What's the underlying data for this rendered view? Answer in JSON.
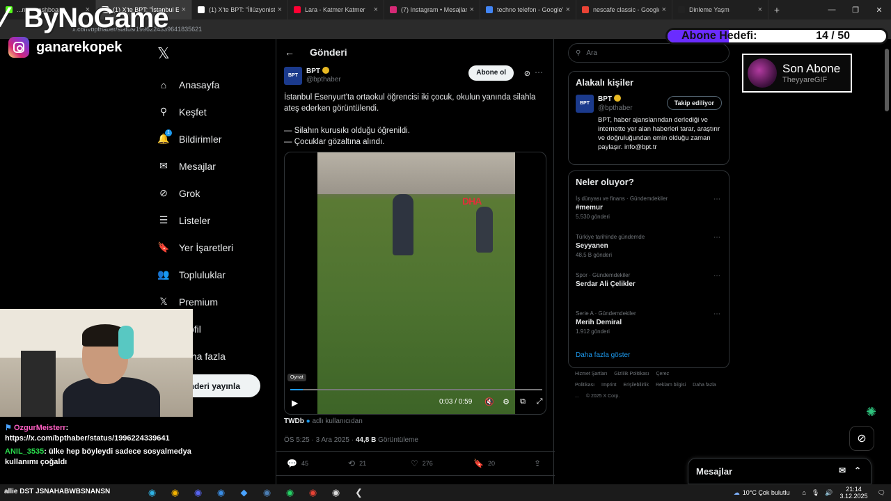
{
  "browser": {
    "tabs": [
      {
        "title": "...m - ...ashboard",
        "color": "#53fc18"
      },
      {
        "title": "(1) X'te BPT: \"İstanbul Ese",
        "color": "#ffffff",
        "active": true
      },
      {
        "title": "(1) X'te BPT: \"İllüzyonist A",
        "color": "#ffffff"
      },
      {
        "title": "Lara - Katmer Katmer",
        "color": "#ff0033"
      },
      {
        "title": "(7) Instagram • Mesajlar",
        "color": "#d62976"
      },
      {
        "title": "techno telefon - Google'c",
        "color": "#4285f4"
      },
      {
        "title": "nescafe classic - Google A",
        "color": "#ea4335"
      },
      {
        "title": "Dinleme Yaşm",
        "color": "#222222"
      }
    ],
    "new_tab": "+",
    "url": "x.com/bpthaber/status/1996224339641835621"
  },
  "overlay": {
    "logo": "ByNoGame",
    "instagram_handle": "ganarekopek",
    "sub_goal_label": "Abone Hedefi:",
    "sub_goal_count": "14 / 50",
    "sub_goal_fraction": 0.28,
    "last_sub_title": "Son Abone",
    "last_sub_name": "TheyyareGIF",
    "chat": [
      {
        "user": "OzgurMeisterr",
        "text": "https://x.com/bpthaber/status/1996224339641",
        "user_color": "#ff5fc3"
      },
      {
        "user": "ANIL_3535",
        "text": "ülke hep böyleydi sadece sosyalmedya kullanımı çoğaldı",
        "user_color": "#29d94c"
      }
    ],
    "ticker": "allie DST JSNAHABWBSNANSN"
  },
  "nav": {
    "items": [
      {
        "label": "Anasayfa",
        "icon": "home-icon",
        "glyph": "⌂"
      },
      {
        "label": "Keşfet",
        "icon": "search-icon",
        "glyph": "⚲"
      },
      {
        "label": "Bildirimler",
        "icon": "bell-icon",
        "glyph": "🔔"
      },
      {
        "label": "Mesajlar",
        "icon": "mail-icon",
        "glyph": "✉"
      },
      {
        "label": "Grok",
        "icon": "grok-icon",
        "glyph": "⊘"
      },
      {
        "label": "Listeler",
        "icon": "list-icon",
        "glyph": "☰"
      },
      {
        "label": "Yer İşaretleri",
        "icon": "bookmark-icon",
        "glyph": "🔖"
      },
      {
        "label": "Topluluklar",
        "icon": "community-icon",
        "glyph": "👥"
      },
      {
        "label": "Premium",
        "icon": "x-icon",
        "glyph": "𝕏"
      },
      {
        "label": "Profil",
        "icon": "profile-icon",
        "glyph": "👤"
      },
      {
        "label": "Daha fazla",
        "icon": "more-icon",
        "glyph": "⋯"
      }
    ],
    "notif_badge": "1",
    "post_button": "Gönderi yayınla"
  },
  "post": {
    "header": "Gönderi",
    "author_name": "BPT",
    "author_handle": "@bpthaber",
    "avatar_text": "BPT",
    "follow_label": "Abone ol",
    "text_lines": [
      "İstanbul Esenyurt'ta ortaokul öğrencisi iki çocuk, okulun yanında silahla ateş ederken görüntülendi.",
      "— Silahın kurusıkı olduğu öğrenildi.",
      "— Çocuklar gözaltına alındı."
    ],
    "video": {
      "watermark": "DHA",
      "tooltip": "Oynat",
      "time": "0:03 / 0:59",
      "progress": 0.05
    },
    "via_user": "TWDb",
    "via_text": "adlı kullanıcıdan",
    "meta_time": "ÖS 5:25 · 3 Ara 2025 · ",
    "views": "44,8 B",
    "views_label": " Görüntüleme",
    "stats": {
      "replies": "45",
      "reposts": "21",
      "likes": "276",
      "bookmarks": "20"
    }
  },
  "right": {
    "search_placeholder": "Ara",
    "related_title": "Alakalı kişiler",
    "related": {
      "name": "BPT",
      "handle": "@bpthaber",
      "button": "Takip ediliyor",
      "bio": "BPT, haber ajanslarından derlediği ve internette yer alan haberleri tarar, araştırır ve doğruluğundan emin olduğu zaman paylaşır. info@bpt.tr"
    },
    "trends_title": "Neler oluyor?",
    "trends": [
      {
        "category": "İş dünyası ve finans · Gündemdekiler",
        "name": "#memur",
        "count": "5.530 gönderi"
      },
      {
        "category": "Türkiye tarihinde gündemde",
        "name": "Seyyanen",
        "count": "48,5 B gönderi"
      },
      {
        "category": "Spor · Gündemdekiler",
        "name": "Serdar Ali Çelikler",
        "count": ""
      },
      {
        "category": "Serie A · Gündemdekiler",
        "name": "Merih Demiral",
        "count": "1.912 gönderi"
      }
    ],
    "show_more": "Daha fazla göster",
    "footer": [
      "Hizmet Şartları",
      "Gizlilik Politikası",
      "Çerez Politikası",
      "Imprint",
      "Erişilebilirlik",
      "Reklam bilgisi",
      "Daha fazla ...",
      "© 2025 X Corp."
    ]
  },
  "messages_label": "Mesajlar",
  "taskbar": {
    "weather": "10°C  Çok bulutlu",
    "time": "21:14",
    "date": "3.12.2025"
  },
  "colors": {
    "accent": "#1d9bf0",
    "goal_fill": "#6a2cff"
  }
}
